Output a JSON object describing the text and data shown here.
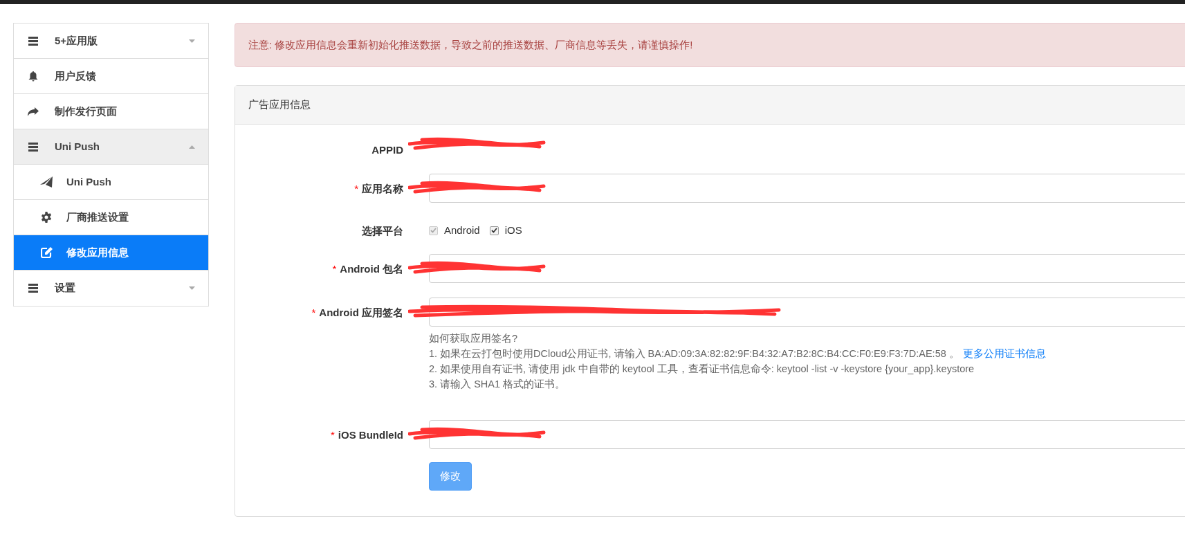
{
  "sidebar": {
    "items": [
      {
        "label": "5+应用版",
        "selected": false,
        "expanded": false
      },
      {
        "label": "用户反馈",
        "selected": false
      },
      {
        "label": "制作发行页面",
        "selected": false
      },
      {
        "label": "Uni Push",
        "selected": false,
        "expanded": true,
        "children": [
          {
            "label": "Uni Push",
            "selected": false
          },
          {
            "label": "厂商推送设置",
            "selected": false
          },
          {
            "label": "修改应用信息",
            "selected": true
          }
        ]
      },
      {
        "label": "设置",
        "selected": false,
        "expanded": false
      }
    ]
  },
  "alert": "注意: 修改应用信息会重新初始化推送数据，导致之前的推送数据、厂商信息等丢失，请谨慎操作!",
  "panel": {
    "title": "广告应用信息",
    "rows": [
      {
        "kind": "text",
        "label": "APPID",
        "redacted": true
      },
      {
        "kind": "input",
        "marker": "*",
        "label": "应用名称",
        "redacted": true
      },
      {
        "kind": "checks",
        "label": "选择平台",
        "options": [
          {
            "label": "Android",
            "checked": true,
            "disabled": true
          },
          {
            "label": "iOS",
            "checked": true,
            "disabled": false
          }
        ]
      },
      {
        "kind": "input",
        "marker": "*",
        "label": "Android 包名",
        "redacted": true
      },
      {
        "kind": "input",
        "marker": "*",
        "label": "Android 应用签名",
        "redacted": true,
        "help": {
          "title": "如何获取应用签名?",
          "lines": [
            {
              "text": "1. 如果在云打包时使用DCloud公用证书, 请输入 BA:AD:09:3A:82:82:9F:B4:32:A7:B2:8C:B4:CC:F0:E9:F3:7D:AE:58 。",
              "link": "更多公用证书信息"
            },
            {
              "text": "2. 如果使用自有证书, 请使用 jdk 中自带的 keytool 工具，查看证书信息命令: keytool -list -v -keystore {your_app}.keystore"
            },
            {
              "text": "3. 请输入 SHA1 格式的证书。"
            }
          ]
        }
      },
      {
        "kind": "input",
        "marker": "*",
        "label": "iOS BundleId",
        "redacted": true
      }
    ],
    "submit": "修改"
  }
}
